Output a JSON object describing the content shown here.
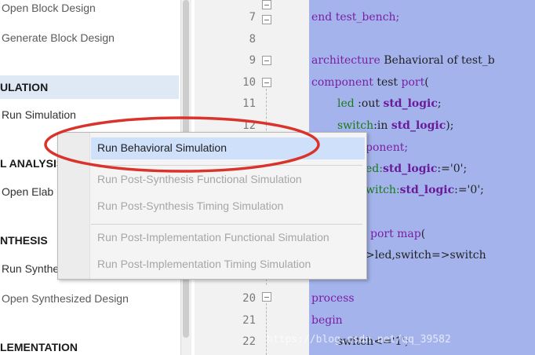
{
  "navigator": {
    "items": [
      {
        "kind": "item",
        "label": "Open Block Design"
      },
      {
        "kind": "item",
        "label": "Generate Block Design"
      },
      {
        "kind": "section",
        "label": "ULATION"
      },
      {
        "kind": "item",
        "label": "Run Simulation"
      },
      {
        "kind": "section",
        "label": "L ANALYSIS"
      },
      {
        "kind": "item",
        "label": "Open Elab"
      },
      {
        "kind": "section",
        "label": "NTHESIS"
      },
      {
        "kind": "item",
        "label": "Run Synthe"
      },
      {
        "kind": "item",
        "label": "Open Synthesized Design"
      },
      {
        "kind": "section",
        "label": "LEMENTATION"
      }
    ]
  },
  "editor": {
    "line_numbers": [
      "7",
      "8",
      "9",
      "10",
      "11",
      "12",
      "20",
      "21",
      "22"
    ],
    "code": {
      "end_line": "end test_bench;",
      "arch_kw": "architecture",
      "arch_rest": " Behavioral of test_b",
      "comp_kw": "component",
      "comp_rest": " test ",
      "port_kw": "port",
      "port_rest": "(",
      "led_name": "led",
      "led_mid": " :out ",
      "led_type": "std_logic",
      "led_end": ";",
      "sw_name": "switch",
      "sw_mid": ":in ",
      "sw_type": "std_logic",
      "sw_end": ");",
      "endcomp_frag": "ponent;",
      "sig1_frag": "ed:",
      "sig1_type": "std_logic",
      "sig1_val": ":='0';",
      "sig2_frag": "witch:",
      "sig2_type": "std_logic",
      "sig2_val": ":='0';",
      "portmap_kw": "port map",
      "portmap_rest": "(",
      "map_frag": ">led,switch=>switch",
      "process_kw": "process",
      "begin_kw": "begin",
      "assign_line": "switch<='1';"
    }
  },
  "context_menu": {
    "items": [
      {
        "label": "Run Behavioral Simulation",
        "enabled": true,
        "highlighted": true
      },
      {
        "label": "Run Post-Synthesis Functional Simulation",
        "enabled": false
      },
      {
        "label": "Run Post-Synthesis Timing Simulation",
        "enabled": false
      },
      {
        "label": "Run Post-Implementation Functional Simulation",
        "enabled": false
      },
      {
        "label": "Run Post-Implementation Timing Simulation",
        "enabled": false
      }
    ]
  },
  "watermark": "https://blog.csdn.net/qq_39582",
  "colors": {
    "code_background": "#a4b3ec",
    "menu_highlight": "#cfe0fb",
    "annotation": "#d9342b",
    "nav_selection": "#dfe8f5"
  }
}
